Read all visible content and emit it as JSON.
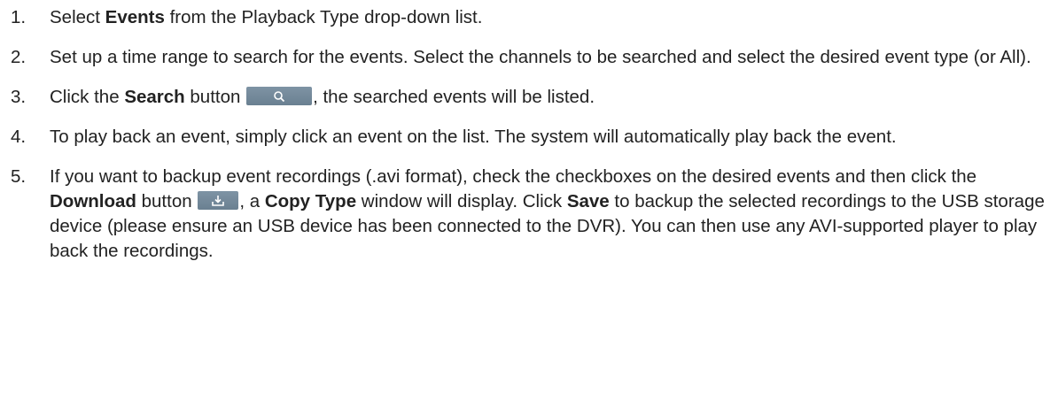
{
  "steps": [
    {
      "num": "1.",
      "a": "Select ",
      "b1": "Events",
      "c": " from the Playback Type drop-down list."
    },
    {
      "num": "2.",
      "text": "Set up a time range to search for the events. Select the channels to be searched and select the desired event type (or All)."
    },
    {
      "num": "3.",
      "a": "Click the ",
      "b1": "Search",
      "c": " button ",
      "d": ", the searched events will be listed.",
      "icon": "search-icon"
    },
    {
      "num": "4.",
      "text": "To play back an event, simply click an event on the list. The system will automatically play back the event."
    },
    {
      "num": "5.",
      "a": "If you want to backup event recordings (.avi format), check the checkboxes on the desired events and then click the ",
      "b1": "Download",
      "c": " button ",
      "d": ", a ",
      "b2": "Copy Type",
      "e": " window will display. Click ",
      "b3": "Save",
      "f": " to backup the selected recordings to the USB storage device (please ensure an USB device has been connected to the DVR). You can then use any AVI-supported player to play back the recordings.",
      "icon": "download-icon"
    }
  ],
  "colors": {
    "button_bg": "#7390a3",
    "icon": "#ffffff"
  }
}
